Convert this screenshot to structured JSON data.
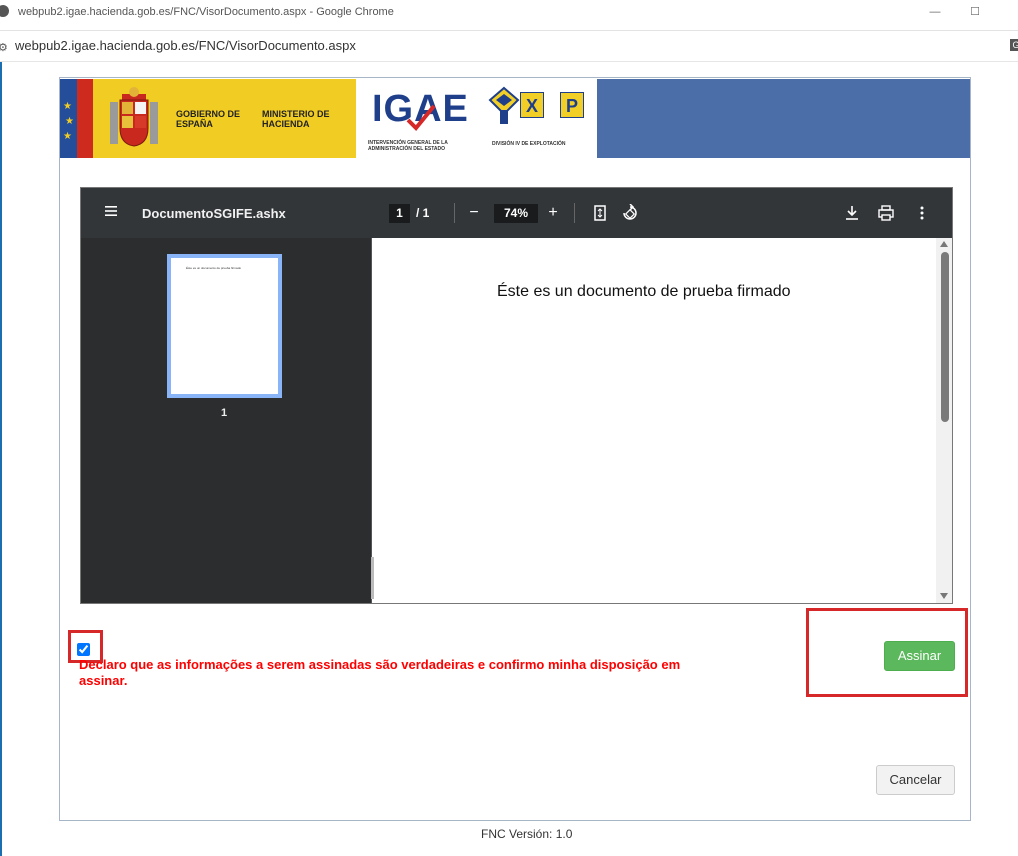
{
  "window": {
    "title": "webpub2.igae.hacienda.gob.es/FNC/VisorDocumento.aspx - Google Chrome",
    "url": "webpub2.igae.hacienda.gob.es/FNC/VisorDocumento.aspx",
    "minimize_glyph": "—",
    "maximize_glyph": "☐"
  },
  "banner": {
    "gobierno": "GOBIERNO DE ESPAÑA",
    "ministerio": "MINISTERIO DE HACIENDA",
    "igae_logo": "IGAE",
    "igae_subtitle": "INTERVENCIÓN GENERAL DE LA ADMINISTRACIÓN DEL ESTADO",
    "exp_letters": [
      "X",
      "P"
    ],
    "exp_subtitle": "DIVISIÓN IV DE EXPLOTACIÓN",
    "colors": {
      "gov_yellow": "#f1cd24",
      "header_blue": "#4b6ea9"
    }
  },
  "pdf_viewer": {
    "doc_name": "DocumentoSGIFE.ashx",
    "page_current": "1",
    "page_total": "/ 1",
    "zoom": "74%",
    "zoom_out": "−",
    "zoom_in": "+",
    "thumbnail_label": "1",
    "thumbnail_text": "Éste es un documento de prueba firmado",
    "document_text": "Éste es un documento de prueba firmado",
    "icons": [
      "menu-icon",
      "fit-page-icon",
      "rotate-icon",
      "download-icon",
      "print-icon",
      "more-icon"
    ]
  },
  "declaration": {
    "checked": true,
    "text": "Declaro que as informações a serem assinadas são verdadeiras e confirmo minha disposição em assinar."
  },
  "buttons": {
    "sign": "Assinar",
    "cancel": "Cancelar"
  },
  "footer": {
    "version": "FNC Versión: 1.0"
  }
}
